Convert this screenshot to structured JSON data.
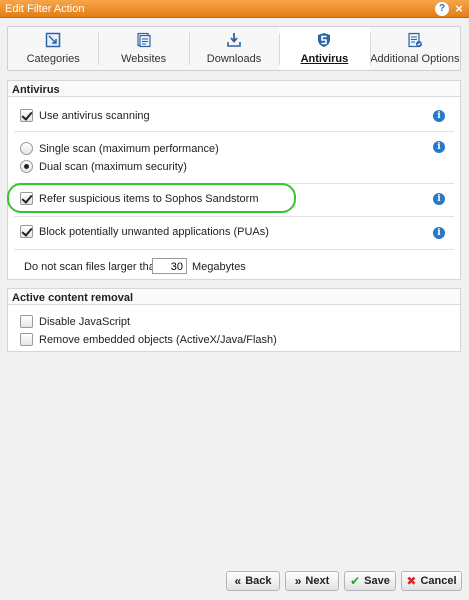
{
  "window": {
    "title": "Edit Filter Action",
    "help_icon": "?",
    "close_icon": "×"
  },
  "tabs": [
    {
      "label": "Categories",
      "icon": "categories-icon",
      "active": false
    },
    {
      "label": "Websites",
      "icon": "websites-icon",
      "active": false
    },
    {
      "label": "Downloads",
      "icon": "downloads-icon",
      "active": false
    },
    {
      "label": "Antivirus",
      "icon": "antivirus-icon",
      "active": true
    },
    {
      "label": "Additional Options",
      "icon": "additional-options-icon",
      "active": false
    }
  ],
  "antivirus": {
    "header": "Antivirus",
    "use_scanning": {
      "label": "Use antivirus scanning",
      "checked": true
    },
    "single_scan": {
      "label": "Single scan (maximum performance)",
      "selected": false
    },
    "dual_scan": {
      "label": "Dual scan (maximum security)",
      "selected": true
    },
    "sandstorm": {
      "label": "Refer suspicious items to Sophos Sandstorm",
      "checked": true
    },
    "pua": {
      "label": "Block potentially unwanted applications (PUAs)",
      "checked": true
    },
    "max_size": {
      "label": "Do not scan files larger than:",
      "value": "30",
      "unit": "Megabytes"
    },
    "info_icon": "i"
  },
  "active_content": {
    "header": "Active content removal",
    "disable_js": {
      "label": "Disable JavaScript",
      "checked": false
    },
    "remove_embedded": {
      "label": "Remove embedded objects (ActiveX/Java/Flash)",
      "checked": false
    }
  },
  "buttons": {
    "back": {
      "label": "Back",
      "icon": "«"
    },
    "next": {
      "label": "Next",
      "icon": "»"
    },
    "save": {
      "label": "Save",
      "icon": "✔"
    },
    "cancel": {
      "label": "Cancel",
      "icon": "✖"
    }
  },
  "colors": {
    "titlebar": "#e9881f",
    "highlight": "#33c633",
    "info": "#2a78c8",
    "save_check": "#2e9b2e",
    "cancel_x": "#d42a2a"
  }
}
